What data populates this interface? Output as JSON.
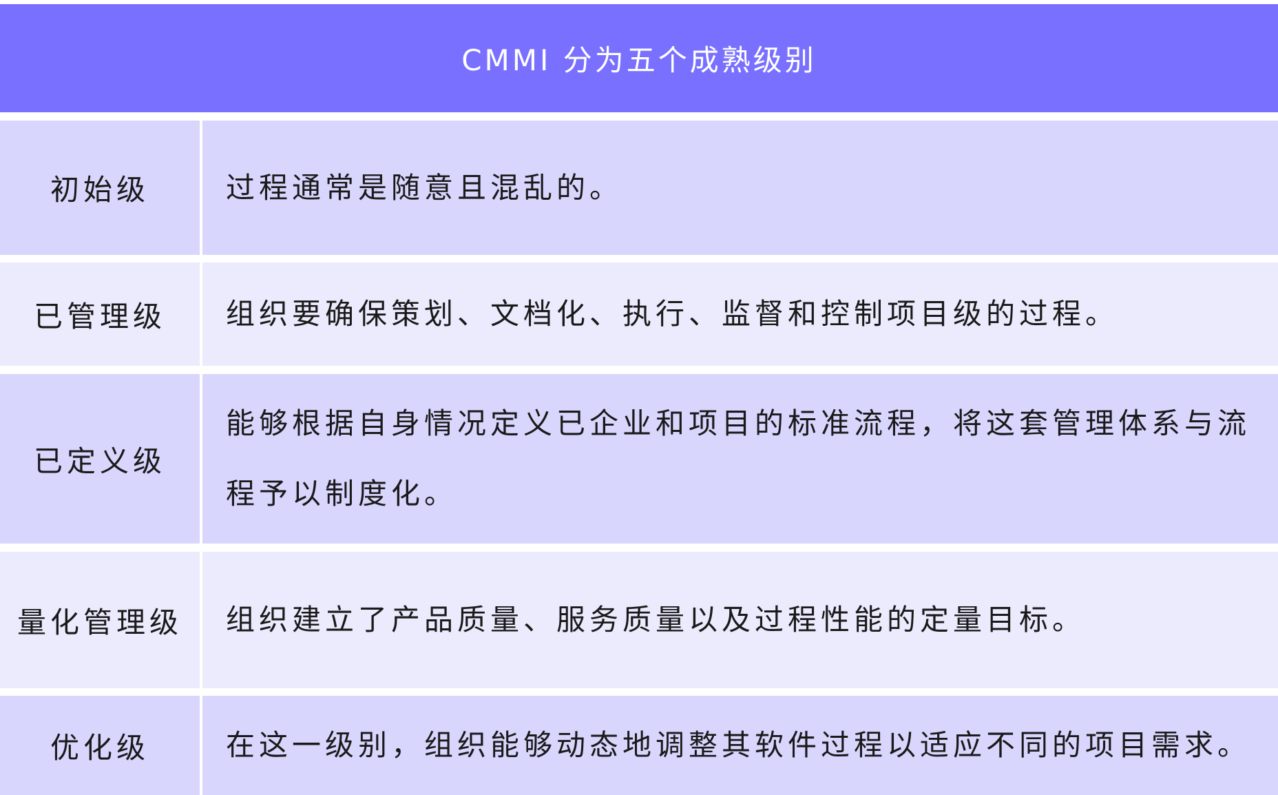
{
  "table": {
    "title": "CMMI 分为五个成熟级别",
    "rows": [
      {
        "level": "初始级",
        "description": "过程通常是随意且混乱的。"
      },
      {
        "level": "已管理级",
        "description": "组织要确保策划、文档化、执行、监督和控制项目级的过程。"
      },
      {
        "level": "已定义级",
        "description": "能够根据自身情况定义已企业和项目的标准流程，将这套管理体系与流程予以制度化。"
      },
      {
        "level": "量化管理级",
        "description": "组织建立了产品质量、服务质量以及过程性能的定量目标。"
      },
      {
        "level": "优化级",
        "description": "在这一级别，组织能够动态地调整其软件过程以适应不同的项目需求。"
      }
    ]
  }
}
